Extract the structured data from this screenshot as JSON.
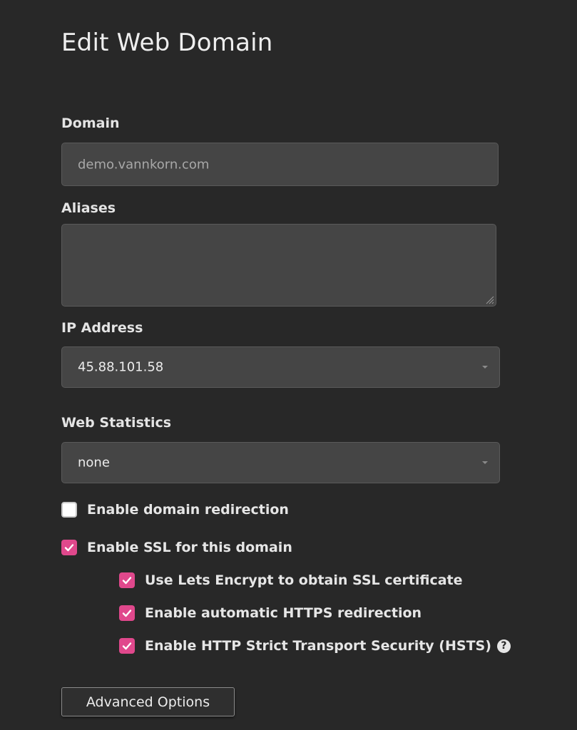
{
  "page": {
    "title": "Edit Web Domain"
  },
  "domain": {
    "label": "Domain",
    "placeholder": "demo.vannkorn.com"
  },
  "aliases": {
    "label": "Aliases",
    "value": ""
  },
  "ip_address": {
    "label": "IP Address",
    "selected": "45.88.101.58"
  },
  "web_statistics": {
    "label": "Web Statistics",
    "selected": "none"
  },
  "options": {
    "domain_redirection": {
      "label": "Enable domain redirection",
      "checked": false
    },
    "ssl": {
      "label": "Enable SSL for this domain",
      "checked": true
    },
    "lets_encrypt": {
      "label": "Use Lets Encrypt to obtain SSL certificate",
      "checked": true
    },
    "https_redirection": {
      "label": "Enable automatic HTTPS redirection",
      "checked": true
    },
    "hsts": {
      "label": "Enable HTTP Strict Transport Security (HSTS)",
      "checked": true,
      "help_icon": "question-circle-icon"
    }
  },
  "buttons": {
    "advanced": "Advanced Options"
  },
  "colors": {
    "background": "#282828",
    "field": "#454545",
    "checkbox_accent": "#e0488c"
  }
}
